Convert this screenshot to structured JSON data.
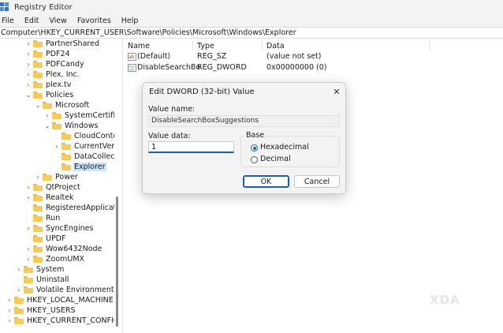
{
  "window": {
    "title": "Registry Editor"
  },
  "menu": [
    {
      "label": "File"
    },
    {
      "label": "Edit"
    },
    {
      "label": "View"
    },
    {
      "label": "Favorites"
    },
    {
      "label": "Help"
    }
  ],
  "address": {
    "path": "Computer\\HKEY_CURRENT_USER\\Software\\Policies\\Microsoft\\Windows\\Explorer"
  },
  "tree": [
    {
      "label": "PartnerShared",
      "chevron": "right"
    },
    {
      "label": "PDF24",
      "chevron": "right"
    },
    {
      "label": "PDFCandy",
      "chevron": "right"
    },
    {
      "label": "Plex, Inc.",
      "chevron": "right"
    },
    {
      "label": "plex.tv",
      "chevron": "right"
    },
    {
      "label": "Policies",
      "chevron": "down"
    },
    {
      "label": "Microsoft",
      "chevron": "down"
    },
    {
      "label": "SystemCertificates",
      "chevron": "right"
    },
    {
      "label": "Windows",
      "chevron": "down"
    },
    {
      "label": "CloudContent",
      "chevron": "none"
    },
    {
      "label": "CurrentVersion",
      "chevron": "right"
    },
    {
      "label": "DataCollection",
      "chevron": "none"
    },
    {
      "label": "Explorer",
      "chevron": "none",
      "selected": true
    },
    {
      "label": "Power",
      "chevron": "right"
    },
    {
      "label": "QtProject",
      "chevron": "right"
    },
    {
      "label": "Realtek",
      "chevron": "right"
    },
    {
      "label": "RegisteredApplications",
      "chevron": "none"
    },
    {
      "label": "Run",
      "chevron": "none"
    },
    {
      "label": "SyncEngines",
      "chevron": "right"
    },
    {
      "label": "UPDF",
      "chevron": "none"
    },
    {
      "label": "Wow6432Node",
      "chevron": "right"
    },
    {
      "label": "ZoomUMX",
      "chevron": "right"
    },
    {
      "label": "System",
      "chevron": "right"
    },
    {
      "label": "Uninstall",
      "chevron": "none"
    },
    {
      "label": "Volatile Environment",
      "chevron": "right"
    },
    {
      "label": "HKEY_LOCAL_MACHINE",
      "chevron": "right"
    },
    {
      "label": "HKEY_USERS",
      "chevron": "right"
    },
    {
      "label": "HKEY_CURRENT_CONFIG",
      "chevron": "right"
    }
  ],
  "columns": {
    "name": "Name",
    "type": "Type",
    "data": "Data"
  },
  "values": [
    {
      "name": "(Default)",
      "type": "REG_SZ",
      "data": "(value not set)",
      "icon": "string-value-icon"
    },
    {
      "name": "DisableSearchBo...",
      "type": "REG_DWORD",
      "data": "0x00000000 (0)",
      "icon": "binary-value-icon"
    }
  ],
  "dialog": {
    "title": "Edit DWORD (32-bit) Value",
    "value_name_label": "Value name:",
    "value_name": "DisableSearchBoxSuggestions",
    "value_data_label": "Value data:",
    "value_data": "1",
    "base_label": "Base",
    "hex_label": "Hexadecimal",
    "dec_label": "Decimal",
    "selected_base": "Hexadecimal",
    "ok_label": "OK",
    "cancel_label": "Cancel"
  },
  "watermark": {
    "text": "XDA"
  },
  "colors": {
    "accent": "#1a5fb4",
    "folder": "#f4cb5c",
    "selection": "#cce4f7"
  }
}
